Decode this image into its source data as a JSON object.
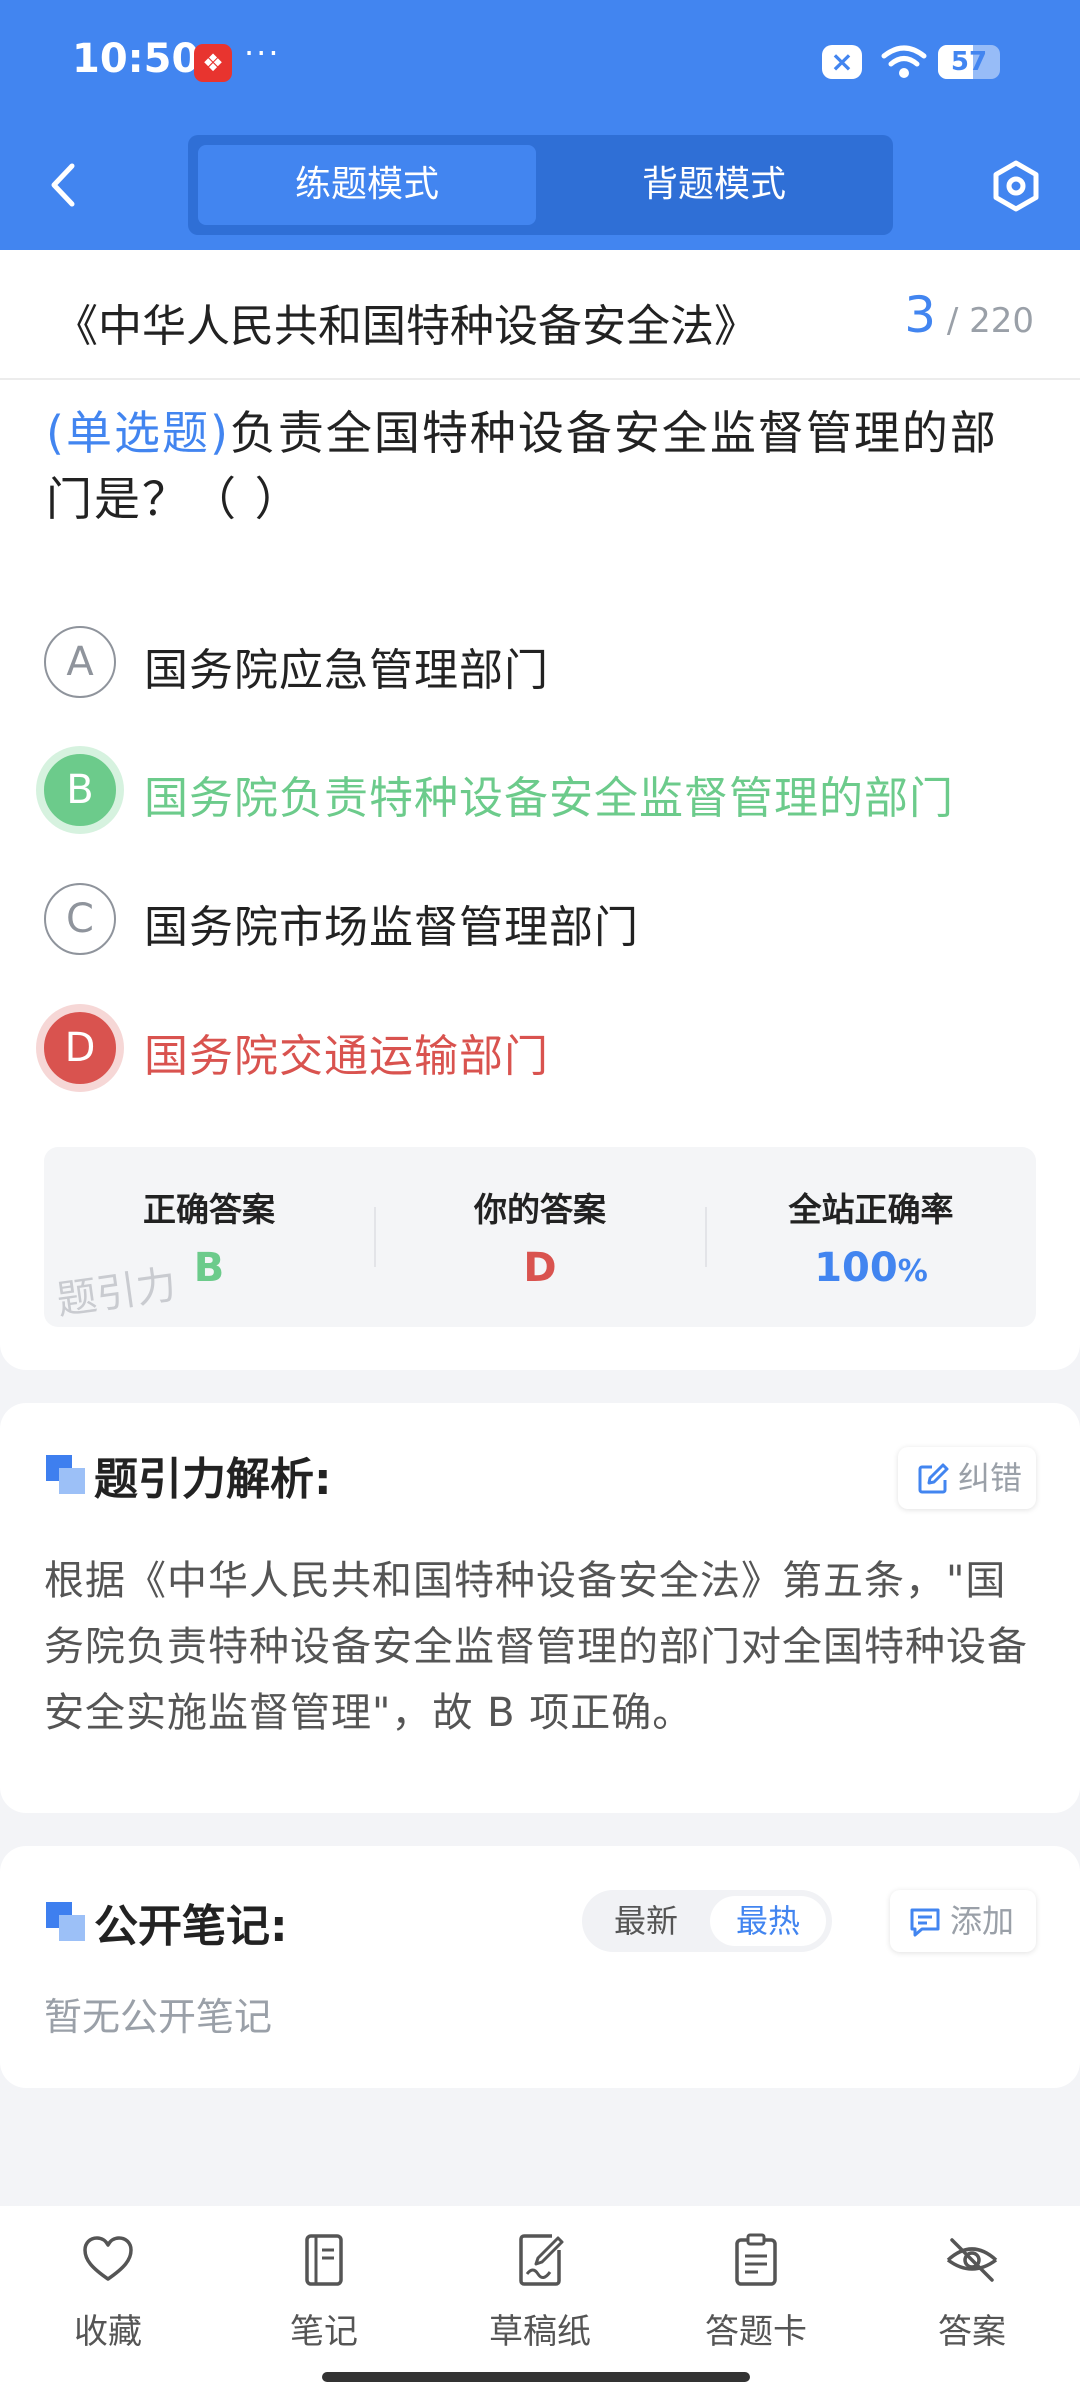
{
  "status_bar": {
    "time": "10:50",
    "more": "···",
    "battery": "57"
  },
  "header": {
    "tabs": [
      "练题模式",
      "背题模式"
    ],
    "active_tab": "练题模式"
  },
  "exam": {
    "book_title": "《中华人民共和国特种设备安全法》",
    "current": "3",
    "total": "/ 220"
  },
  "question": {
    "type": "(单选题)",
    "text": "负责全国特种设备安全监督管理的部门是？（        ）",
    "options": [
      {
        "letter": "A",
        "text": "国务院应急管理部门",
        "state": "normal"
      },
      {
        "letter": "B",
        "text": "国务院负责特种设备安全监督管理的部门",
        "state": "correct"
      },
      {
        "letter": "C",
        "text": "国务院市场监督管理部门",
        "state": "normal"
      },
      {
        "letter": "D",
        "text": "国务院交通运输部门",
        "state": "wrong"
      }
    ]
  },
  "answer_summary": {
    "correct_label": "正确答案",
    "correct_value": "B",
    "yours_label": "你的答案",
    "yours_value": "D",
    "rate_label": "全站正确率",
    "rate_value": "100",
    "rate_unit": "%",
    "watermark": "题引力"
  },
  "analysis": {
    "title": "题引力解析:",
    "report_label": "纠错",
    "text": "根据《中华人民共和国特种设备安全法》第五条，\"国务院负责特种设备安全监督管理的部门对全国特种设备安全实施监督管理\"，故 B 项正确。"
  },
  "notes": {
    "title": "公开笔记:",
    "sort_options": [
      "最新",
      "最热"
    ],
    "active_sort": "最热",
    "add_label": "添加",
    "empty_text": "暂无公开笔记"
  },
  "bottom_nav": [
    {
      "label": "收藏",
      "icon": "heart-icon"
    },
    {
      "label": "笔记",
      "icon": "notebook-icon"
    },
    {
      "label": "草稿纸",
      "icon": "draft-paper-icon"
    },
    {
      "label": "答题卡",
      "icon": "answer-card-icon"
    },
    {
      "label": "答案",
      "icon": "eye-off-icon"
    }
  ],
  "colors": {
    "primary": "#4285f0",
    "correct": "#6ccb8b",
    "wrong": "#d9534f"
  }
}
